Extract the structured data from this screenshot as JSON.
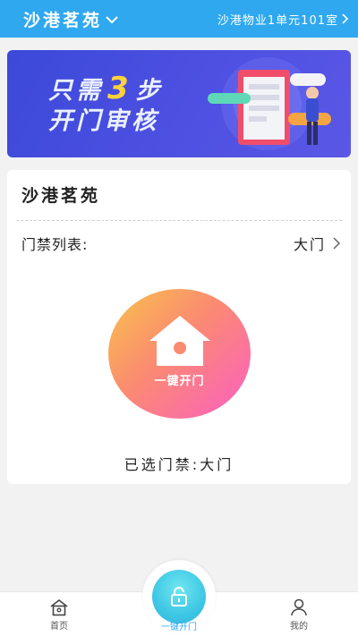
{
  "header": {
    "community": "沙港茗苑",
    "unit": "沙港物业1单元101室"
  },
  "banner": {
    "line1_pre": "只需",
    "line1_num": "3",
    "line1_post": "步",
    "line2": "开门审核"
  },
  "card": {
    "title": "沙港茗苑",
    "gate_list_label": "门禁列表:",
    "gate_value": "大门",
    "open_button_label": "一键开门",
    "selected_text": "已选门禁:大门"
  },
  "nav": {
    "home": "首页",
    "center": "一键开门",
    "mine": "我的"
  },
  "colors": {
    "primary": "#2fa8f0",
    "banner": "#4b4fe0",
    "accent": "#ffd23a"
  },
  "icons": [
    "chevron-down-icon",
    "chevron-right-icon",
    "house-icon",
    "home-icon",
    "unlock-icon",
    "user-icon"
  ]
}
